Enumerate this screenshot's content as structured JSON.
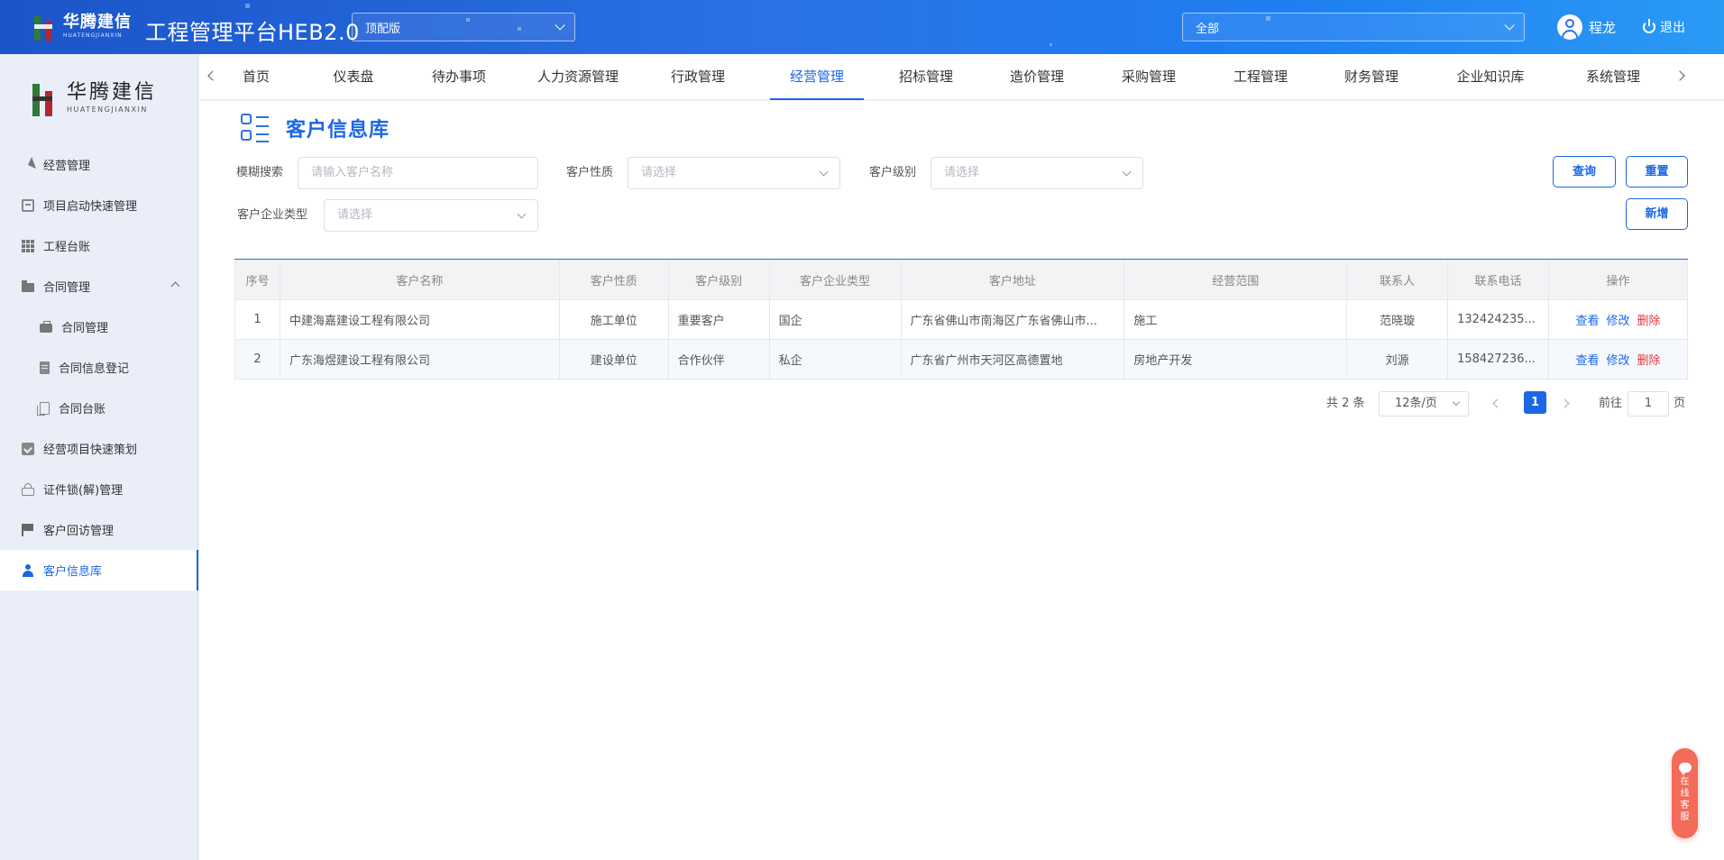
{
  "header": {
    "logo_cn": "华腾建信",
    "logo_en": "HUATENGJIANXIN",
    "app_title": "工程管理平台HEB2.0",
    "version_select": "顶配版",
    "scope_select": "全部",
    "user_name": "程龙",
    "logout_label": "退出"
  },
  "sidebar": {
    "logo_cn": "华腾建信",
    "logo_en": "HUATENGJIANXIN",
    "items": [
      {
        "label": "经营管理",
        "icon": "send-icon"
      },
      {
        "label": "项目启动快速管理",
        "icon": "inbox-icon"
      },
      {
        "label": "工程台账",
        "icon": "grid-icon"
      },
      {
        "label": "合同管理",
        "icon": "folder-icon",
        "expanded": true
      },
      {
        "label": "合同管理",
        "icon": "briefcase-icon",
        "sub": true
      },
      {
        "label": "合同信息登记",
        "icon": "clipboard-icon",
        "sub": true
      },
      {
        "label": "合同台账",
        "icon": "documents-icon",
        "sub": true
      },
      {
        "label": "经营项目快速策划",
        "icon": "checklist-icon"
      },
      {
        "label": "证件锁(解)管理",
        "icon": "lock-icon"
      },
      {
        "label": "客户回访管理",
        "icon": "flag-icon"
      },
      {
        "label": "客户信息库",
        "icon": "user-icon",
        "active": true
      }
    ]
  },
  "nav": {
    "tabs": [
      "首页",
      "仪表盘",
      "待办事项",
      "人力资源管理",
      "行政管理",
      "经营管理",
      "招标管理",
      "造价管理",
      "采购管理",
      "工程管理",
      "财务管理",
      "企业知识库",
      "系统管理"
    ],
    "active_index": 5
  },
  "page": {
    "title": "客户信息库",
    "filters": {
      "fuzzy_label": "模糊搜索",
      "fuzzy_placeholder": "请输入客户名称",
      "nature_label": "客户性质",
      "nature_placeholder": "请选择",
      "level_label": "客户级别",
      "level_placeholder": "请选择",
      "enterprise_type_label": "客户企业类型",
      "enterprise_type_placeholder": "请选择"
    },
    "buttons": {
      "query": "查询",
      "reset": "重置",
      "add": "新增"
    }
  },
  "table": {
    "columns": [
      "序号",
      "客户名称",
      "客户性质",
      "客户级别",
      "客户企业类型",
      "客户地址",
      "经营范围",
      "联系人",
      "联系电话",
      "操作"
    ],
    "rows": [
      {
        "no": "1",
        "name": "中建海嘉建设工程有限公司",
        "nature": "施工单位",
        "level": "重要客户",
        "type": "国企",
        "address": "广东省佛山市南海区广东省佛山市...",
        "scope": "施工",
        "contact": "范晓璇",
        "phone": "132424235..."
      },
      {
        "no": "2",
        "name": "广东海煜建设工程有限公司",
        "nature": "建设单位",
        "level": "合作伙伴",
        "type": "私企",
        "address": "广东省广州市天河区高德置地",
        "scope": "房地产开发",
        "contact": "刘源",
        "phone": "158427236..."
      }
    ],
    "actions": {
      "view": "查看",
      "edit": "修改",
      "delete": "删除"
    }
  },
  "pagination": {
    "total_text": "共 2 条",
    "page_size": "12条/页",
    "current_page": "1",
    "goto_label": "前往",
    "goto_value": "1",
    "page_suffix": "页"
  },
  "chat_float": {
    "label": "在线客服"
  },
  "colors": {
    "primary": "#1b67e6",
    "danger": "#e0383e",
    "header_start": "#1a55c9",
    "header_end": "#2a9af5",
    "chat": "#f26b5b"
  }
}
